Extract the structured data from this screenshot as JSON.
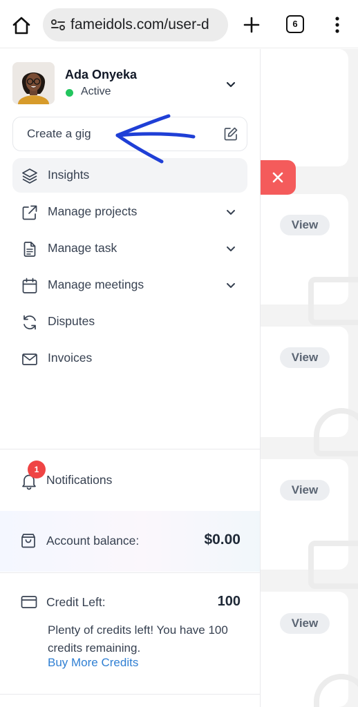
{
  "browser": {
    "url": "fameidols.com/user-d",
    "tab_count": "6"
  },
  "background_page": {
    "view_buttons": [
      "View",
      "View",
      "View",
      "View"
    ]
  },
  "sidebar": {
    "user": {
      "name": "Ada Onyeka",
      "status": "Active"
    },
    "create_gig": "Create a gig",
    "nav_items": [
      {
        "label": "Insights",
        "icon": "layers-icon",
        "active": true,
        "has_submenu": false
      },
      {
        "label": "Manage projects",
        "icon": "external-link-icon",
        "active": false,
        "has_submenu": true
      },
      {
        "label": "Manage task",
        "icon": "document-icon",
        "active": false,
        "has_submenu": true
      },
      {
        "label": "Manage meetings",
        "icon": "calendar-icon",
        "active": false,
        "has_submenu": true
      },
      {
        "label": "Disputes",
        "icon": "refresh-icon",
        "active": false,
        "has_submenu": false
      },
      {
        "label": "Invoices",
        "icon": "mail-icon",
        "active": false,
        "has_submenu": false
      }
    ],
    "notifications": {
      "label": "Notifications",
      "count": "1"
    },
    "account_balance": {
      "label": "Account balance:",
      "value": "$0.00"
    },
    "credit": {
      "label": "Credit Left:",
      "value": "100",
      "message": "Plenty of credits left! You have 100 credits remaining.",
      "link": "Buy More Credits"
    }
  },
  "colors": {
    "accent_link": "#2f7fd3",
    "status_active": "#22c55e",
    "badge": "#ef4444",
    "close_button": "#f45b5b",
    "annotation_arrow": "#1f3fd6"
  }
}
